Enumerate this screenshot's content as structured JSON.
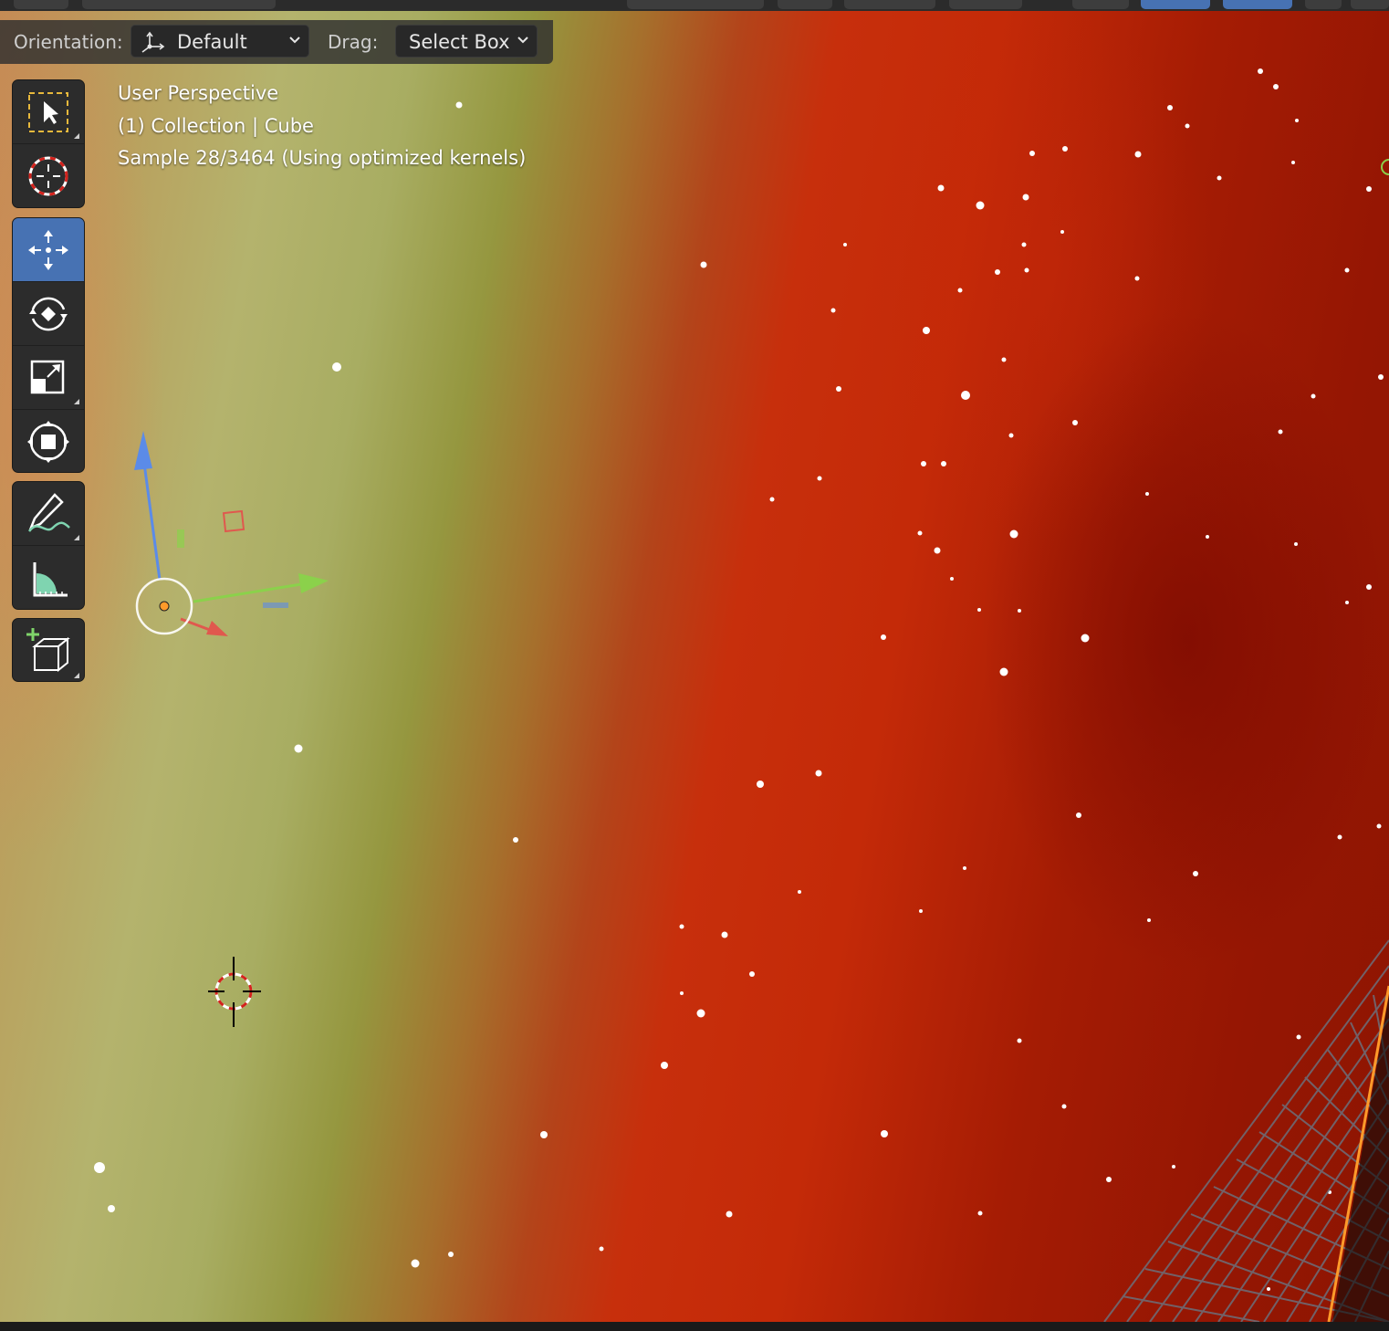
{
  "colors": {
    "header_bg": "#303030",
    "active_tool": "#4772b3",
    "axis_x": "#e0584e",
    "axis_y": "#8bd14b",
    "axis_z": "#5b8be8",
    "selection_outline": "#ff9a2a"
  },
  "tool_header": {
    "orientation_label": "Orientation:",
    "orientation_value": "Default",
    "drag_label": "Drag:",
    "drag_value": "Select Box"
  },
  "overlay": {
    "view_name": "User Perspective",
    "collection_info": "(1) Collection | Cube",
    "render_status": "Sample 28/3464 (Using optimized kernels)"
  },
  "toolbar": {
    "groups": [
      {
        "tools": [
          {
            "name": "select-box",
            "icon": "select-box-icon",
            "active": false
          },
          {
            "name": "cursor",
            "icon": "cursor-icon",
            "active": false
          }
        ]
      },
      {
        "tools": [
          {
            "name": "move",
            "icon": "move-icon",
            "active": true
          },
          {
            "name": "rotate",
            "icon": "rotate-icon",
            "active": false
          },
          {
            "name": "scale",
            "icon": "scale-icon",
            "active": false
          },
          {
            "name": "transform",
            "icon": "transform-icon",
            "active": false
          }
        ]
      },
      {
        "tools": [
          {
            "name": "annotate",
            "icon": "annotate-icon",
            "active": false
          },
          {
            "name": "measure",
            "icon": "measure-icon",
            "active": false
          }
        ]
      },
      {
        "tools": [
          {
            "name": "add-cube",
            "icon": "add-cube-icon",
            "active": false
          }
        ]
      }
    ]
  }
}
